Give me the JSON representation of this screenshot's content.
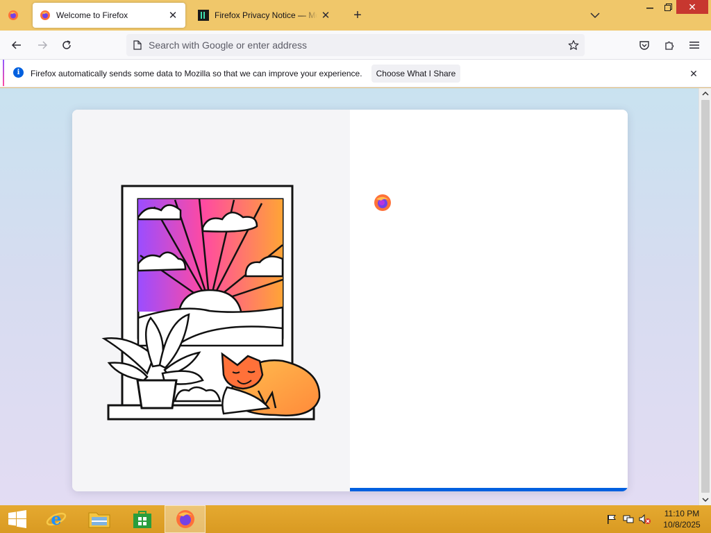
{
  "browser": {
    "tabs": [
      {
        "title": "Welcome to Firefox",
        "active": true,
        "icon": "firefox-icon"
      },
      {
        "title": "Firefox Privacy Notice — Mozilla",
        "active": false,
        "icon": "mozilla-m-icon"
      }
    ],
    "address_bar": {
      "placeholder": "Search with Google or enter address",
      "value": ""
    },
    "colors": {
      "tab_strip": "#f0c76a",
      "accent": "#0060df"
    }
  },
  "notification": {
    "message": "Firefox automatically sends some data to Mozilla so that we can improve your experience.",
    "button_label": "Choose What I Share"
  },
  "welcome_card": {
    "progress": 1.0
  },
  "taskbar": {
    "pinned": [
      "windows-start-icon",
      "internet-explorer-icon",
      "file-explorer-icon",
      "store-icon",
      "firefox-icon"
    ],
    "clock": {
      "time": "11:10 PM",
      "date": "10/8/2025"
    }
  }
}
